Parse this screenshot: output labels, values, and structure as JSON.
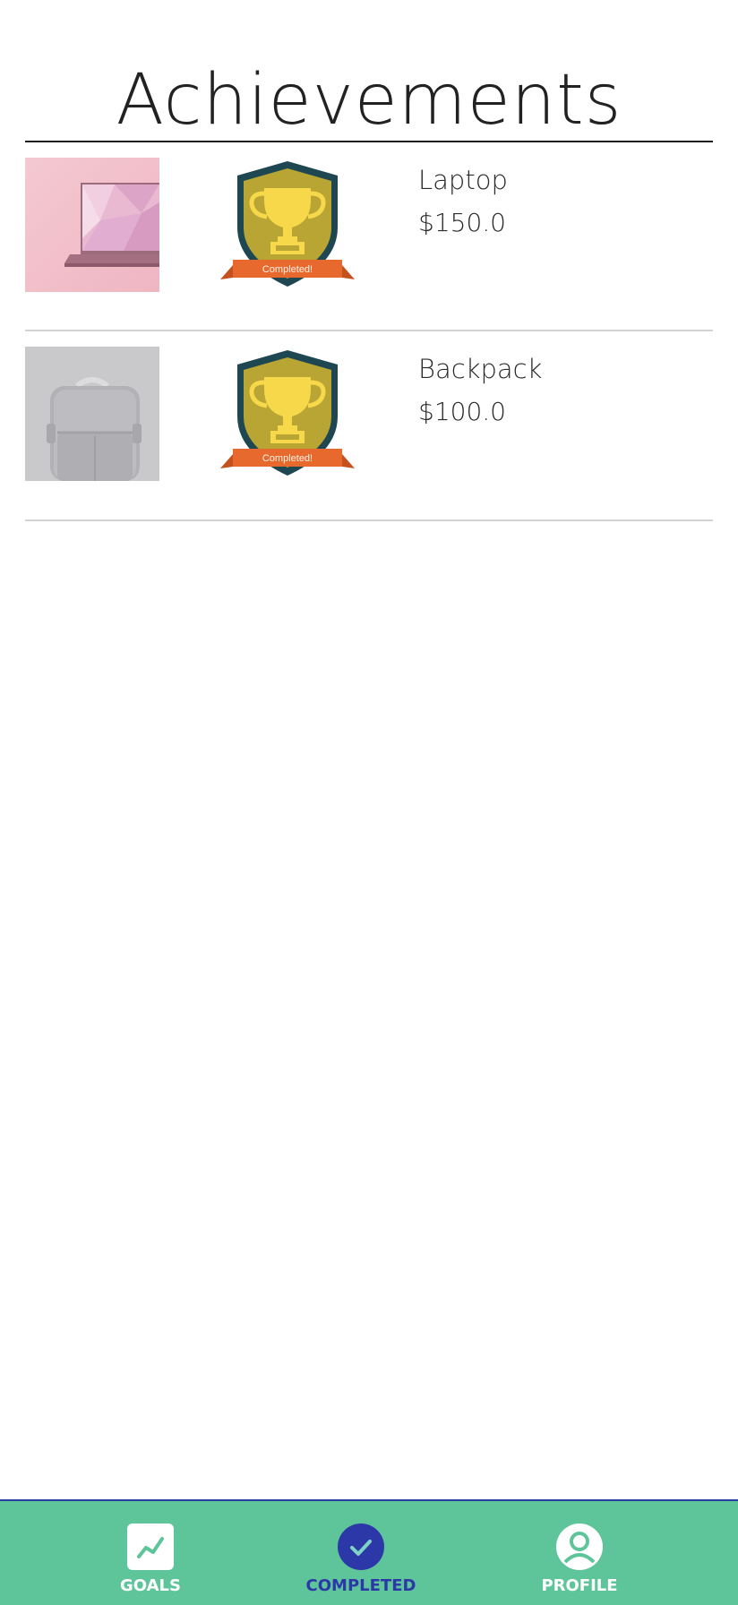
{
  "header": {
    "title": "Achievements"
  },
  "achievements": [
    {
      "name": "Laptop",
      "price": "$150.0",
      "badge_text": "Completed!",
      "image_icon": "laptop-image"
    },
    {
      "name": "Backpack",
      "price": "$100.0",
      "badge_text": "Completed!",
      "image_icon": "backpack-image"
    }
  ],
  "nav": {
    "items": [
      {
        "label": "GOALS",
        "icon": "trending-chart-icon",
        "active": false
      },
      {
        "label": "COMPLETED",
        "icon": "check-circle-icon",
        "active": true
      },
      {
        "label": "PROFILE",
        "icon": "user-circle-icon",
        "active": false
      }
    ]
  },
  "colors": {
    "nav_background": "#5ec49a",
    "nav_active": "#2c37a8",
    "badge_shield": "#b9a534",
    "badge_border": "#1e4752",
    "badge_trophy": "#f6d84a",
    "badge_ribbon": "#e8692e"
  }
}
